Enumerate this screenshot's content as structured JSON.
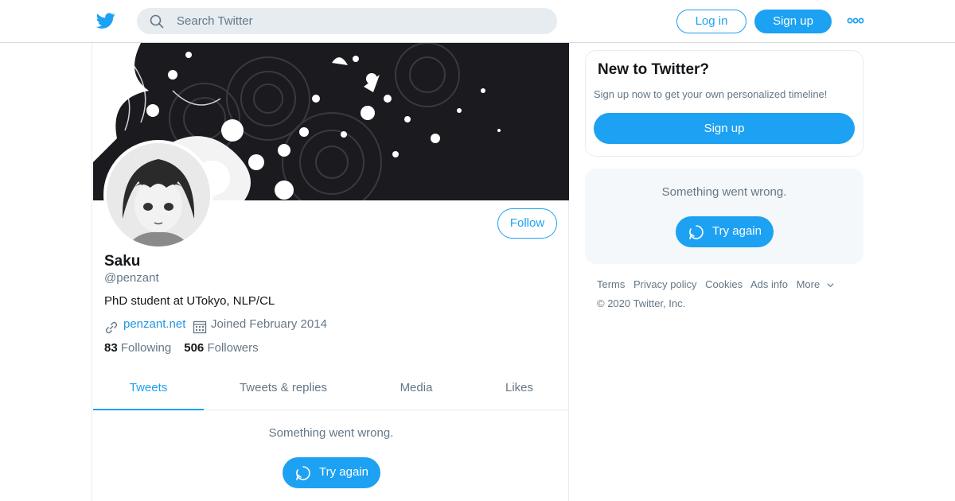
{
  "header": {
    "search_placeholder": "Search Twitter",
    "login_label": "Log in",
    "signup_label": "Sign up"
  },
  "profile": {
    "follow_label": "Follow",
    "name": "Saku",
    "handle": "@penzant",
    "bio": "PhD student at UTokyo, NLP/CL",
    "website": "penzant.net",
    "joined": "Joined February 2014",
    "following_count": "83",
    "following_label": "Following",
    "followers_count": "506",
    "followers_label": "Followers"
  },
  "tabs": [
    {
      "label": "Tweets",
      "active": true
    },
    {
      "label": "Tweets & replies",
      "active": false
    },
    {
      "label": "Media",
      "active": false
    },
    {
      "label": "Likes",
      "active": false
    }
  ],
  "timeline": {
    "error_text": "Something went wrong.",
    "retry_label": "Try again"
  },
  "sidebar": {
    "new_title": "New to Twitter?",
    "new_desc": "Sign up now to get your own personalized timeline!",
    "signup_label": "Sign up",
    "error_text": "Something went wrong.",
    "retry_label": "Try again"
  },
  "footer": {
    "links": [
      "Terms",
      "Privacy policy",
      "Cookies",
      "Ads info",
      "More"
    ],
    "copyright": "© 2020 Twitter, Inc."
  },
  "colors": {
    "accent": "#1da1f2",
    "link": "#1b95e0",
    "secondary_text": "#657786",
    "banner_bg": "#1b1a1f"
  },
  "icons": [
    "twitter-bird-icon",
    "search-icon",
    "more-dots-icon",
    "link-icon",
    "calendar-icon",
    "retry-icon",
    "chevron-down-icon"
  ]
}
